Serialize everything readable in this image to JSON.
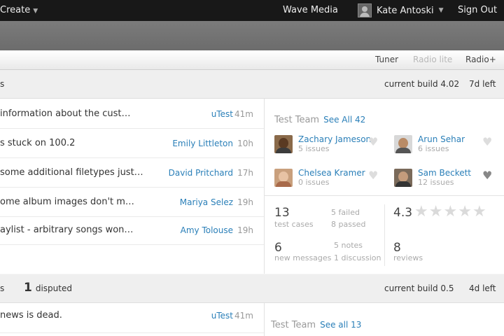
{
  "topbar": {
    "create_label": "Create",
    "company": "Wave Media",
    "user_name": "Kate Antoski",
    "signout": "Sign Out"
  },
  "subnav": {
    "tabs": [
      "Tuner",
      "Radio lite",
      "Radio+"
    ]
  },
  "section1": {
    "header_trunc": "s",
    "build": "current build 4.02",
    "time_left": "7d left",
    "messages": [
      {
        "text": "information about the cust…",
        "author": "uTest",
        "time": "41m"
      },
      {
        "text": "s stuck on 100.2",
        "author": "Emily Littleton",
        "time": "10h"
      },
      {
        "text": "some additional filetypes just…",
        "author": "David Pritchard",
        "time": "17h"
      },
      {
        "text": "ome album images don't m…",
        "author": "Mariya Selez",
        "time": "19h"
      },
      {
        "text": "aylist - arbitrary songs won…",
        "author": "Amy Tolouse",
        "time": "19h"
      }
    ],
    "team": {
      "title": "Test Team",
      "see_all": "See All 42",
      "members": [
        {
          "name": "Zachary Jameson",
          "issues": "5 issues",
          "favorite": false
        },
        {
          "name": "Arun Sehar",
          "issues": "6 issues",
          "favorite": false
        },
        {
          "name": "Chelsea Kramer",
          "issues": "0 issues",
          "favorite": false
        },
        {
          "name": "Sam Beckett",
          "issues": "12 issues",
          "favorite": true
        }
      ]
    },
    "stats": {
      "test_cases_num": "13",
      "test_cases_lbl": "test cases",
      "failed": "5 failed",
      "passed": "8 passed",
      "rating": "4.3",
      "rating_value": 4.3,
      "rating_max": 5,
      "messages_num": "6",
      "messages_lbl": "new messages",
      "notes": "5 notes",
      "discussion": "1 discussion",
      "reviews_num": "8",
      "reviews_lbl": "reviews"
    }
  },
  "section2": {
    "header_trunc": "s",
    "disputed_num": "1",
    "disputed_lbl": "disputed",
    "build": "current build 0.5",
    "time_left": "4d left",
    "messages": [
      {
        "text": "news is dead.",
        "author": "uTest",
        "time": "41m"
      }
    ],
    "team": {
      "title": "Test Team",
      "see_all": "See all 13"
    }
  }
}
